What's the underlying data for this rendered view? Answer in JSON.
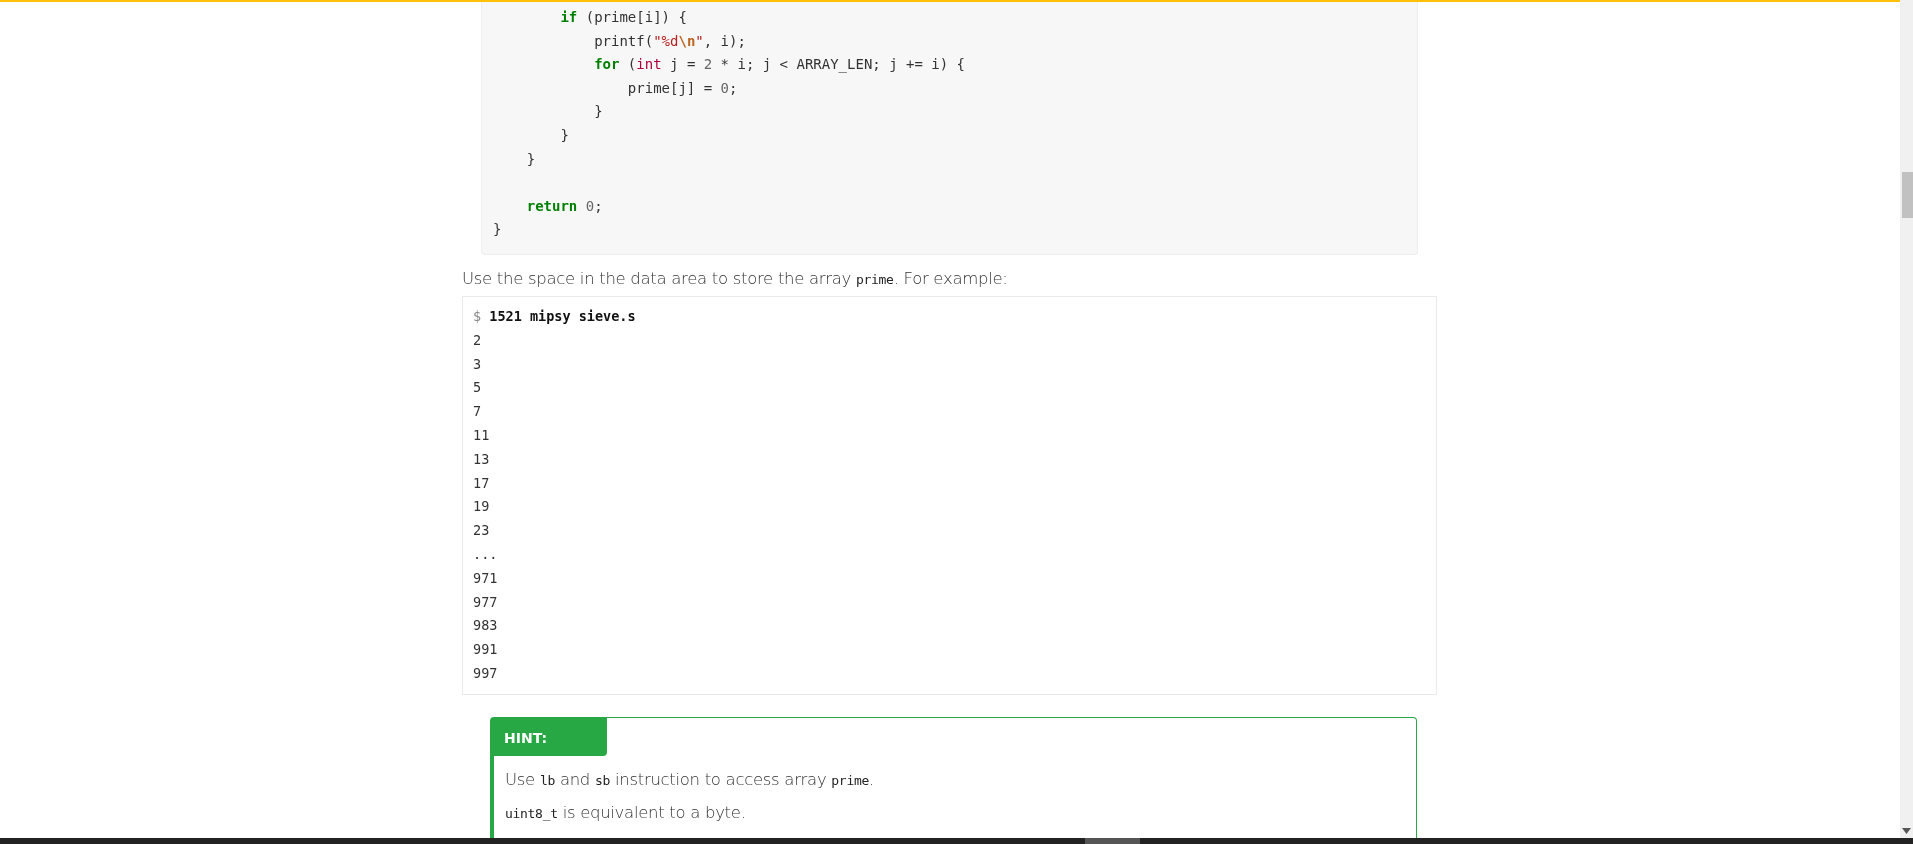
{
  "code_block": {
    "lines": [
      {
        "tokens": [
          {
            "kind": "keyword",
            "text": "        if"
          },
          {
            "kind": "plain",
            "text": " (prime[i]) {"
          }
        ]
      },
      {
        "tokens": [
          {
            "kind": "plain",
            "text": "            printf("
          },
          {
            "kind": "string",
            "text": "\"%d"
          },
          {
            "kind": "escape",
            "text": "\\n"
          },
          {
            "kind": "string",
            "text": "\""
          },
          {
            "kind": "plain",
            "text": ", i);"
          }
        ]
      },
      {
        "tokens": [
          {
            "kind": "keyword",
            "text": "            for"
          },
          {
            "kind": "plain",
            "text": " ("
          },
          {
            "kind": "type",
            "text": "int"
          },
          {
            "kind": "plain",
            "text": " j = "
          },
          {
            "kind": "number",
            "text": "2"
          },
          {
            "kind": "plain",
            "text": " * i; j < ARRAY_LEN; j += i) {"
          }
        ]
      },
      {
        "tokens": [
          {
            "kind": "plain",
            "text": "                prime[j] = "
          },
          {
            "kind": "number",
            "text": "0"
          },
          {
            "kind": "plain",
            "text": ";"
          }
        ]
      },
      {
        "tokens": [
          {
            "kind": "plain",
            "text": "            }"
          }
        ]
      },
      {
        "tokens": [
          {
            "kind": "plain",
            "text": "        }"
          }
        ]
      },
      {
        "tokens": [
          {
            "kind": "plain",
            "text": "    }"
          }
        ]
      },
      {
        "kind": "blank"
      },
      {
        "tokens": [
          {
            "kind": "keyword",
            "text": "    return "
          },
          {
            "kind": "number",
            "text": "0"
          },
          {
            "kind": "plain",
            "text": ";"
          }
        ]
      },
      {
        "tokens": [
          {
            "kind": "plain",
            "text": "}"
          }
        ]
      }
    ]
  },
  "paragraph": [
    {
      "kind": "text",
      "text": "Use the space in the data area to store the array "
    },
    {
      "kind": "code",
      "text": "prime"
    },
    {
      "kind": "text",
      "text": ". For example:"
    }
  ],
  "terminal": {
    "prompt": "$",
    "command": "1521 mipsy sieve.s",
    "output": [
      "2",
      "3",
      "5",
      "7",
      "11",
      "13",
      "17",
      "19",
      "23",
      "...",
      "971",
      "977",
      "983",
      "991",
      "997"
    ]
  },
  "hint": {
    "title": "HINT:",
    "paragraphs": [
      [
        {
          "kind": "text",
          "text": "Use "
        },
        {
          "kind": "code",
          "text": "lb"
        },
        {
          "kind": "text",
          "text": " and "
        },
        {
          "kind": "code",
          "text": "sb"
        },
        {
          "kind": "text",
          "text": " instruction to access array "
        },
        {
          "kind": "code",
          "text": "prime"
        },
        {
          "kind": "text",
          "text": "."
        }
      ],
      [
        {
          "kind": "code",
          "text": "uint8_t"
        },
        {
          "kind": "text",
          "text": " is equivalent to a byte."
        }
      ]
    ]
  }
}
